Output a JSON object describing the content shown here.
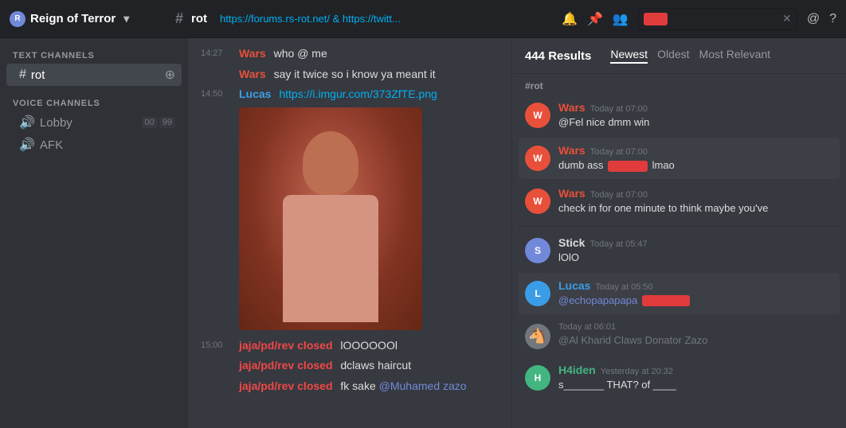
{
  "topbar": {
    "server_name": "Reign of Terror",
    "channel": "rot",
    "links": "https://forums.rs-rot.net/  &  https://twitt...",
    "search_placeholder": "ni",
    "search_redacted": true
  },
  "sidebar": {
    "text_channels_header": "TEXT CHANNELS",
    "voice_channels_header": "VOICE CHANNELS",
    "text_channel": "rot",
    "voice_channels": [
      {
        "name": "Lobby",
        "count_a": "00",
        "count_b": "99"
      },
      {
        "name": "AFK"
      }
    ]
  },
  "messages": [
    {
      "time": "14:27",
      "author": "Wars",
      "author_class": "wars",
      "text": "who @ me"
    },
    {
      "time": "",
      "author": "Wars",
      "author_class": "wars",
      "text": "say it twice so i know ya meant it"
    },
    {
      "time": "14:50",
      "author": "Lucas",
      "author_class": "lucas",
      "text": "https://i.imgur.com/373ZfTE.png",
      "has_image": true
    },
    {
      "time": "15:00",
      "author": "jaja/pd/rev closed",
      "author_class": "jaja",
      "text": "lOOOOOOl"
    },
    {
      "time": "",
      "author": "jaja/pd/rev closed",
      "author_class": "jaja",
      "text": "dclaws haircut"
    },
    {
      "time": "",
      "author": "jaja/pd/rev closed",
      "author_class": "jaja",
      "text": "fk sake @Muhamed zazo"
    }
  ],
  "search_panel": {
    "result_count": "444 Results",
    "channel_label": "#rot",
    "sort_tabs": [
      "Newest",
      "Oldest",
      "Most Relevant"
    ],
    "active_sort": "Newest",
    "results": [
      {
        "avatar_class": "wars",
        "avatar_letter": "W",
        "author": "Wars",
        "author_class": "wars",
        "time": "Today at 07:00",
        "text": "@Fel nice dmm win",
        "highlighted": false
      },
      {
        "avatar_class": "wars",
        "avatar_letter": "W",
        "author": "Wars",
        "author_class": "wars",
        "time": "Today at 07:00",
        "text": "dumb ass n____ lmao",
        "has_redacted": true,
        "redacted_pos": "middle",
        "text_before": "dumb ass ",
        "text_after": " lmao",
        "highlighted": true
      },
      {
        "avatar_class": "wars",
        "avatar_letter": "W",
        "author": "Wars",
        "author_class": "wars",
        "time": "Today at 07:00",
        "text": "check in for one minute to think maybe you've",
        "highlighted": false
      },
      {
        "avatar_class": "stick",
        "avatar_letter": "S",
        "author": "Stick",
        "author_class": "stick",
        "time": "Today at 05:47",
        "text": "lOlO",
        "highlighted": false
      },
      {
        "avatar_class": "lucas",
        "avatar_letter": "L",
        "author": "Lucas",
        "author_class": "lucas",
        "time": "Today at 05:50",
        "text": "@echopapapapa n____",
        "has_redacted": true,
        "text_before": "@echopapapapa ",
        "text_after": "",
        "highlighted": true
      },
      {
        "avatar_class": "unknown",
        "avatar_letter": "?",
        "author": "",
        "author_class": "unknown",
        "time": "Today at 06:01",
        "text": "@Al Kharid Claws Donator Zazo",
        "highlighted": false,
        "is_mention": true
      },
      {
        "avatar_class": "h4iden",
        "avatar_letter": "H",
        "author": "H4iden",
        "author_class": "h4iden",
        "time": "Yesterday at 20:32",
        "text": "s______ THAT? of ___",
        "highlighted": false
      }
    ]
  }
}
